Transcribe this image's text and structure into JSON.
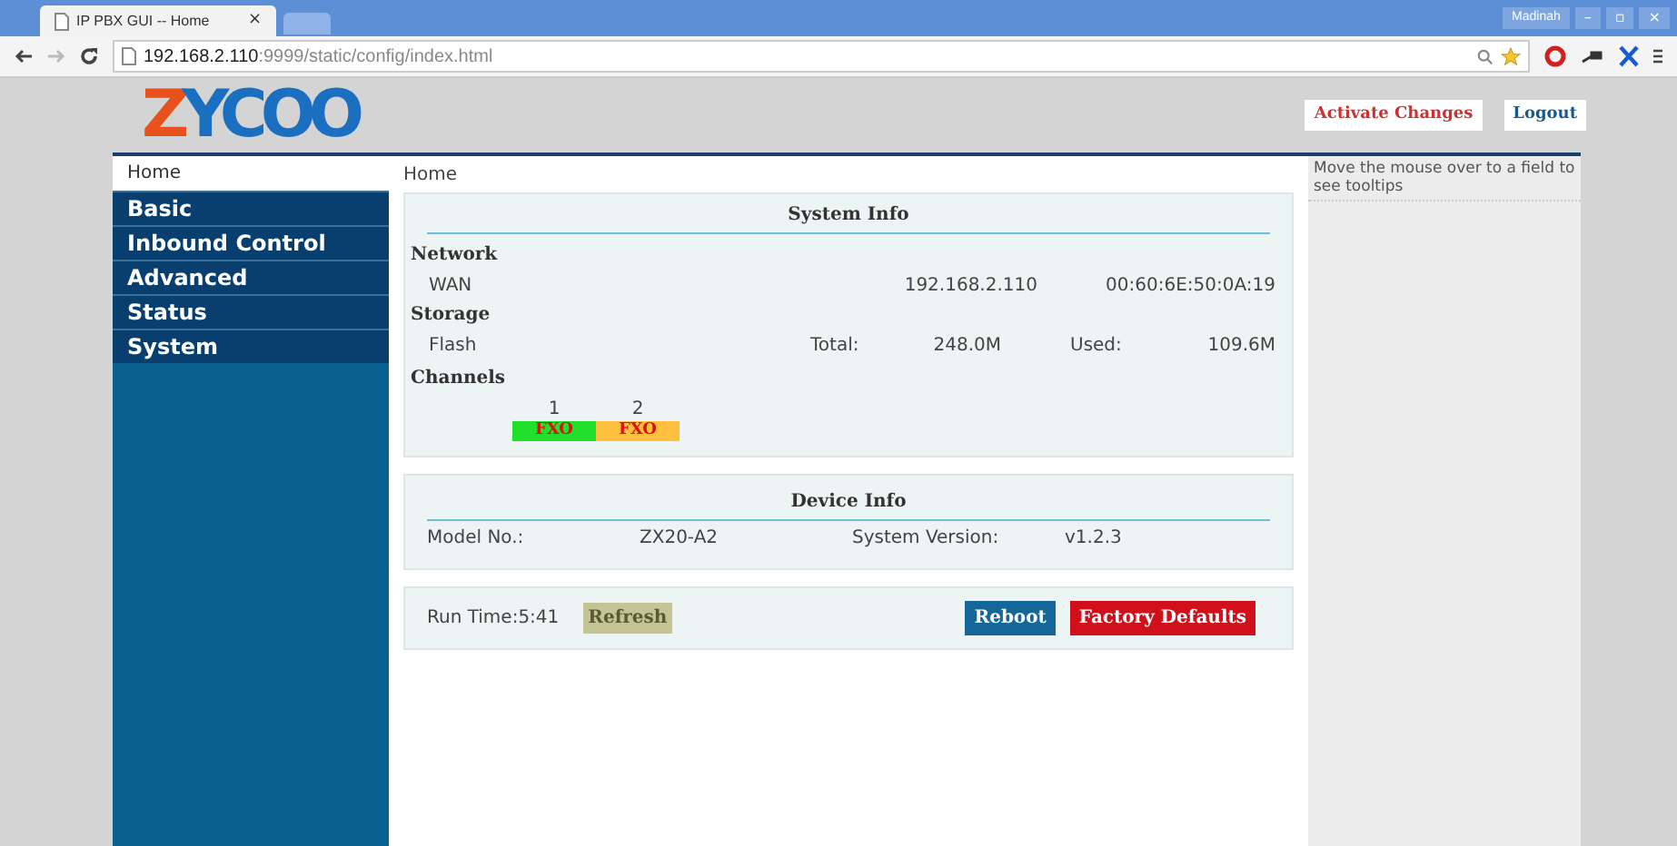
{
  "browser": {
    "tab_title": "IP PBX GUI -- Home",
    "tab_close": "×",
    "profile": "Madinah",
    "window_controls": [
      "–",
      "▫",
      "×"
    ],
    "url_host": "192.168.2.110",
    "url_path": ":9999/static/config/index.html"
  },
  "logo": {
    "part_1": "Z",
    "part_2": "YCOO"
  },
  "header_buttons": [
    {
      "label": "Activate Changes",
      "kind": "alert"
    },
    {
      "label": "Logout",
      "kind": "plain"
    }
  ],
  "sidebar": {
    "items": [
      {
        "label": "Home",
        "selected": true
      },
      {
        "label": "Basic",
        "selected": false
      },
      {
        "label": "Inbound Control",
        "selected": false
      },
      {
        "label": "Advanced",
        "selected": false
      },
      {
        "label": "Status",
        "selected": false
      },
      {
        "label": "System",
        "selected": false
      }
    ]
  },
  "breadcrumb": "Home",
  "system_info": {
    "title": "System Info",
    "network": {
      "heading": "Network",
      "label": "WAN",
      "ip": "192.168.2.110",
      "mac": "00:60:6E:50:0A:19"
    },
    "storage": {
      "heading": "Storage",
      "label": "Flash",
      "total_label": "Total:",
      "total": "248.0M",
      "used_label": "Used:",
      "used": "109.6M"
    },
    "channels": {
      "heading": "Channels",
      "items": [
        {
          "number": "1",
          "type": "FXO",
          "color": "#22e02a"
        },
        {
          "number": "2",
          "type": "FXO",
          "color": "#ffc040"
        }
      ]
    }
  },
  "device_info": {
    "title": "Device Info",
    "model_label": "Model No.:",
    "model": "ZX20-A2",
    "version_label": "System Version:",
    "version": "v1.2.3"
  },
  "runtime": {
    "text": "Run Time:5:41",
    "refresh": {
      "label": "Refresh",
      "disabled": true
    },
    "buttons": [
      {
        "label": "Reboot",
        "kind": "primary"
      },
      {
        "label": "Factory Defaults",
        "kind": "danger"
      }
    ]
  },
  "help": {
    "text": "Move the mouse over to a field to see tooltips"
  }
}
